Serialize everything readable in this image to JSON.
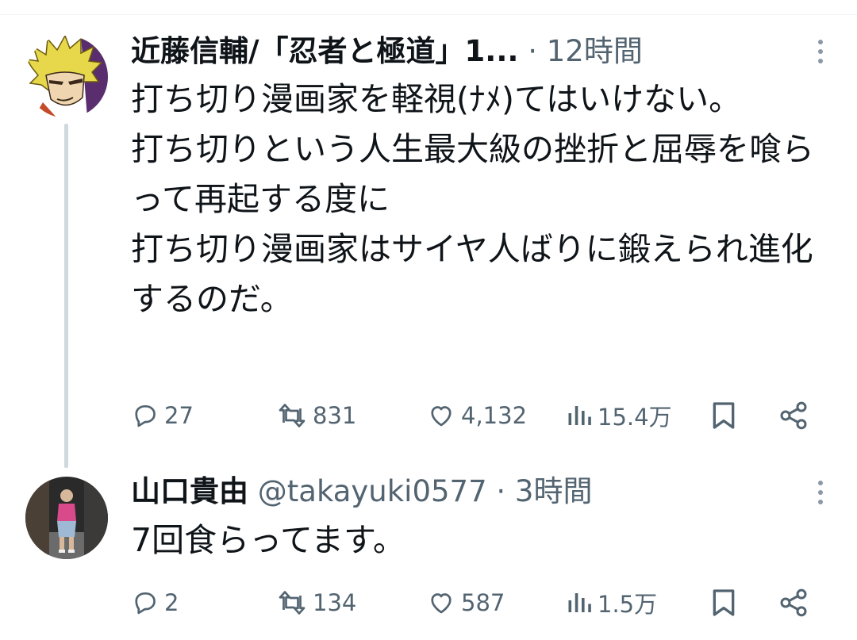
{
  "tweets": [
    {
      "author_name": "近藤信輔/「忍者と極道」1...",
      "handle": "",
      "separator": "·",
      "time": "12時間",
      "text": "打ち切り漫画家を軽視(ﾅﾒ)てはいけない。\n打ち切りという人生最大級の挫折と屈辱を喰らって再起する度に\n打ち切り漫画家はサイヤ人ばりに鍛えられ進化するのだ。",
      "replies": "27",
      "retweets": "831",
      "likes": "4,132",
      "views": "15.4万",
      "avatar_icon": "spiky-blond-manga-character-avatar"
    },
    {
      "author_name": "山口貴由",
      "handle": "@takayuki0577",
      "separator": "·",
      "time": "3時間",
      "text": "7回食らってます。",
      "replies": "2",
      "retweets": "134",
      "likes": "587",
      "views": "1.5万",
      "avatar_icon": "person-photo-avatar"
    }
  ],
  "colors": {
    "text": "#0f1419",
    "secondary": "#536471",
    "thread_line": "#cfd9de",
    "background": "#ffffff"
  }
}
